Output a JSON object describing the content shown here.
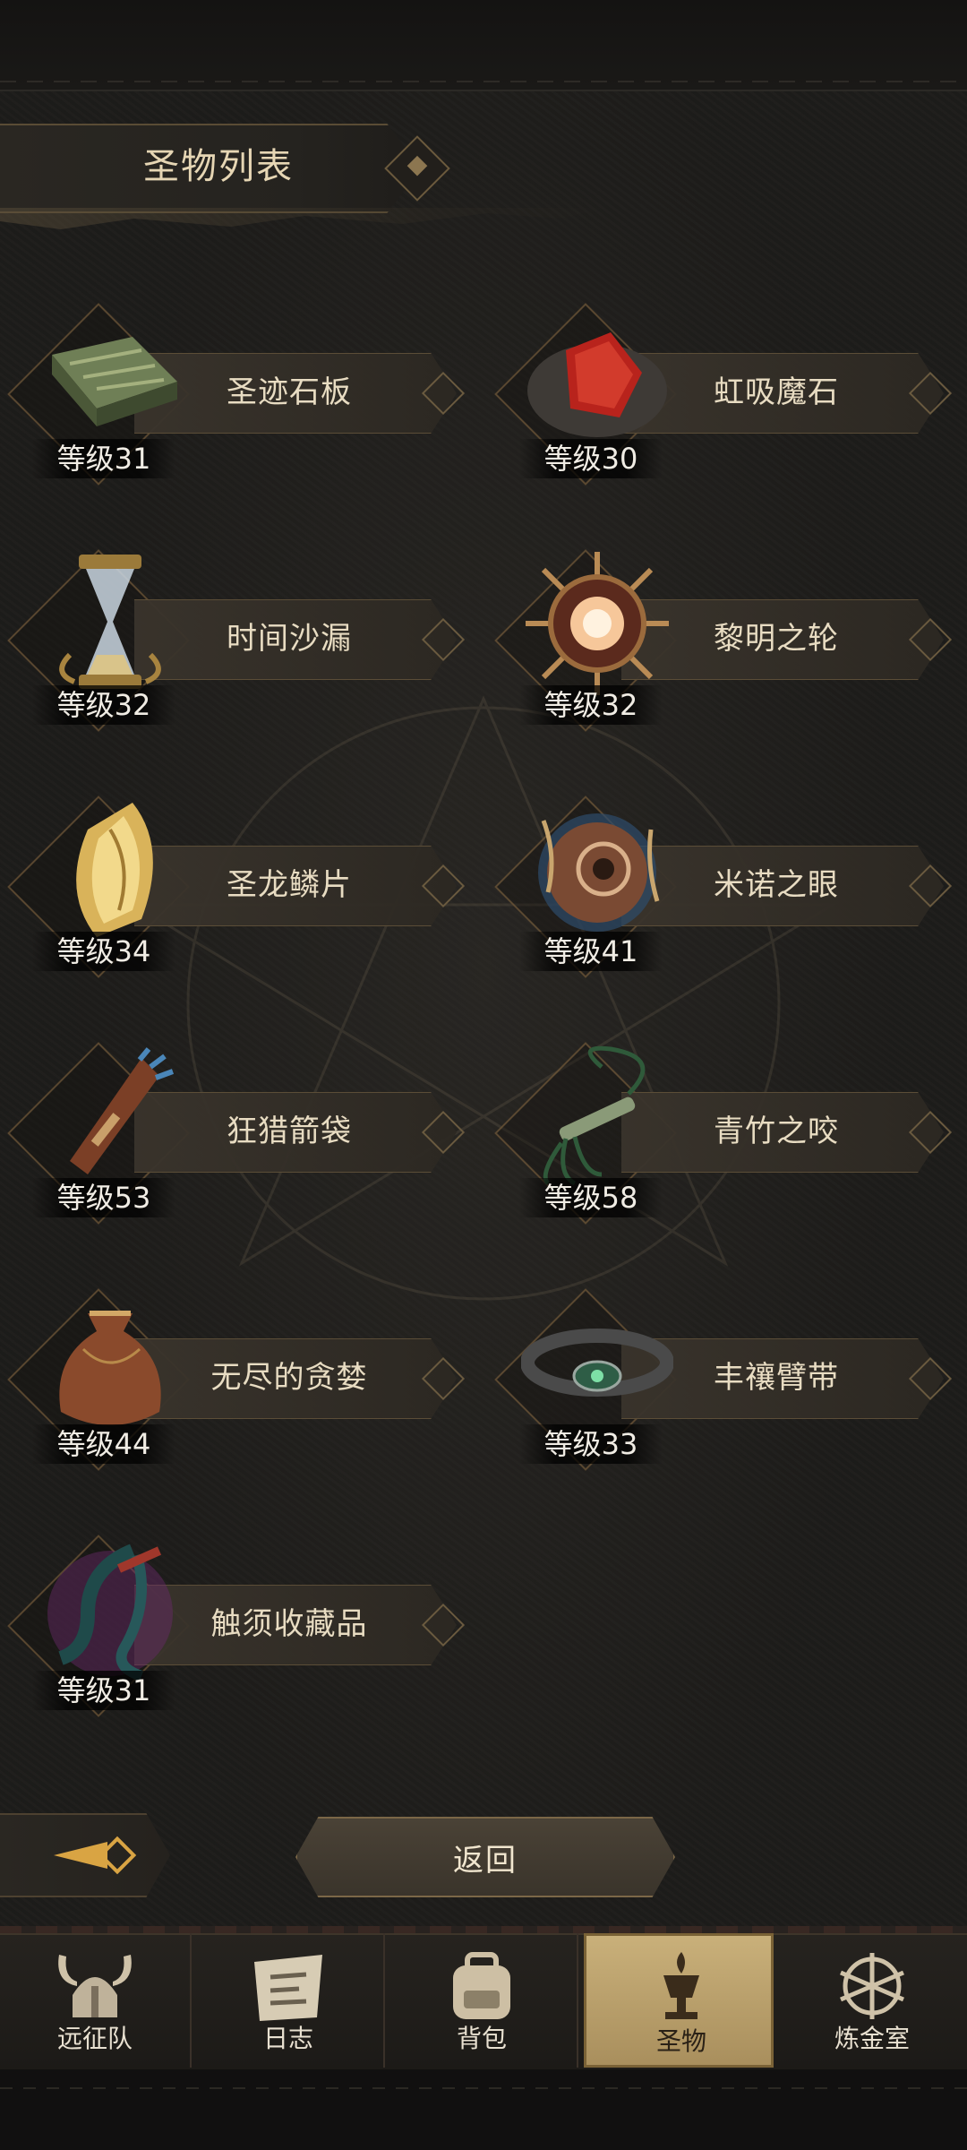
{
  "header": {
    "title": "圣物列表"
  },
  "relics": [
    {
      "name": "圣迹石板",
      "level": "等级31",
      "icon": "stone-tablet-icon"
    },
    {
      "name": "虹吸魔石",
      "level": "等级30",
      "icon": "siphon-stone-icon"
    },
    {
      "name": "时间沙漏",
      "level": "等级32",
      "icon": "hourglass-icon"
    },
    {
      "name": "黎明之轮",
      "level": "等级32",
      "icon": "dawn-wheel-icon"
    },
    {
      "name": "圣龙鳞片",
      "level": "等级34",
      "icon": "dragon-scale-icon"
    },
    {
      "name": "米诺之眼",
      "level": "等级41",
      "icon": "mino-eye-icon"
    },
    {
      "name": "狂猎箭袋",
      "level": "等级53",
      "icon": "quiver-icon"
    },
    {
      "name": "青竹之咬",
      "level": "等级58",
      "icon": "bamboo-whip-icon"
    },
    {
      "name": "无尽的贪婪",
      "level": "等级44",
      "icon": "greed-bag-icon"
    },
    {
      "name": "丰禳臂带",
      "level": "等级33",
      "icon": "armband-icon"
    },
    {
      "name": "触须收藏品",
      "level": "等级31",
      "icon": "tentacle-icon"
    }
  ],
  "controls": {
    "back_label": "返回"
  },
  "nav": {
    "tabs": [
      {
        "label": "远征队",
        "icon": "viking-helmet-icon",
        "active": false
      },
      {
        "label": "日志",
        "icon": "scroll-log-icon",
        "active": false
      },
      {
        "label": "背包",
        "icon": "backpack-icon",
        "active": false
      },
      {
        "label": "圣物",
        "icon": "relic-chalice-icon",
        "active": true
      },
      {
        "label": "炼金室",
        "icon": "alchemy-icon",
        "active": false
      }
    ]
  },
  "colors": {
    "accent_gold": "#c9b07a",
    "text_light": "#e8dcc2",
    "bg": "#1d1c1a"
  }
}
